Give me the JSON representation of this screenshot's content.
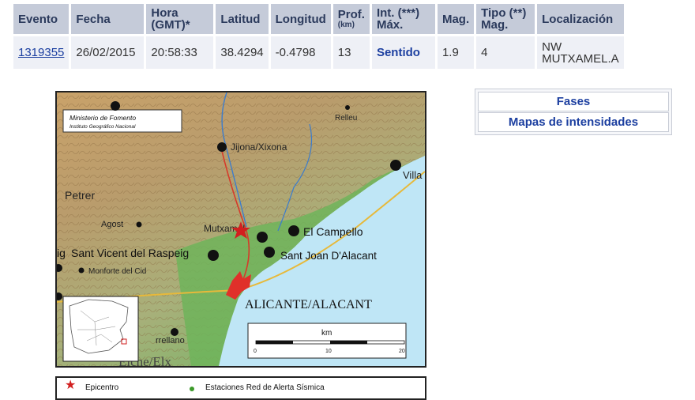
{
  "table": {
    "headers": {
      "evento": "Evento",
      "fecha": "Fecha",
      "hora_line1": "Hora",
      "hora_line2": "(GMT)*",
      "latitud": "Latitud",
      "longitud": "Longitud",
      "prof_line1": "Prof.",
      "prof_unit": "(km)",
      "int_line1": "Int. (***)",
      "int_line2": "Máx.",
      "mag": "Mag.",
      "tipo_line1": "Tipo (**)",
      "tipo_line2": "Mag.",
      "localizacion": "Localización"
    },
    "row": {
      "evento": "1319355",
      "fecha": "26/02/2015",
      "hora": "20:58:33",
      "latitud": "38.4294",
      "longitud": "-0.4798",
      "prof": "13",
      "int_max": "Sentido",
      "mag": "1.9",
      "tipo_mag": "4",
      "loc_line1": "NW",
      "loc_line2": "MUTXAMEL.A"
    }
  },
  "side_links": {
    "fases": "Fases",
    "mapas": "Mapas de intensidades"
  },
  "map": {
    "credit_line1": "Ministerio de Fomento",
    "credit_line2": "Instituto Geográfico Nacional",
    "places": {
      "relleu": "Relleu",
      "jijona": "Jijona/Xixona",
      "villa": "Villa",
      "petrer": "Petrer",
      "agost": "Agost",
      "mutxamel": "Mutxamel",
      "campello": "El Campello",
      "sant_vicent": "Sant Vicent del Raspeig",
      "sant_joan": "Sant Joan  D'Alacant",
      "monforte": "Monforte del Cid",
      "alicante": "ALICANTE/ALACANT",
      "crevillente": "rrellano",
      "elche": "Elche/Elx",
      "vc": "ig"
    },
    "scale": {
      "unit": "km",
      "t0": "0",
      "t10": "10",
      "t20": "20"
    }
  },
  "legend": {
    "epicentro": "Epicentro",
    "estaciones": "Estaciones Red de Alerta Sísmica"
  },
  "colors": {
    "header_bg": "#c5cbd9",
    "cell_bg": "#eef0f6",
    "link": "#1c3fa0",
    "epicenter": "#d21f1f",
    "sea": "#bfe6f6"
  }
}
